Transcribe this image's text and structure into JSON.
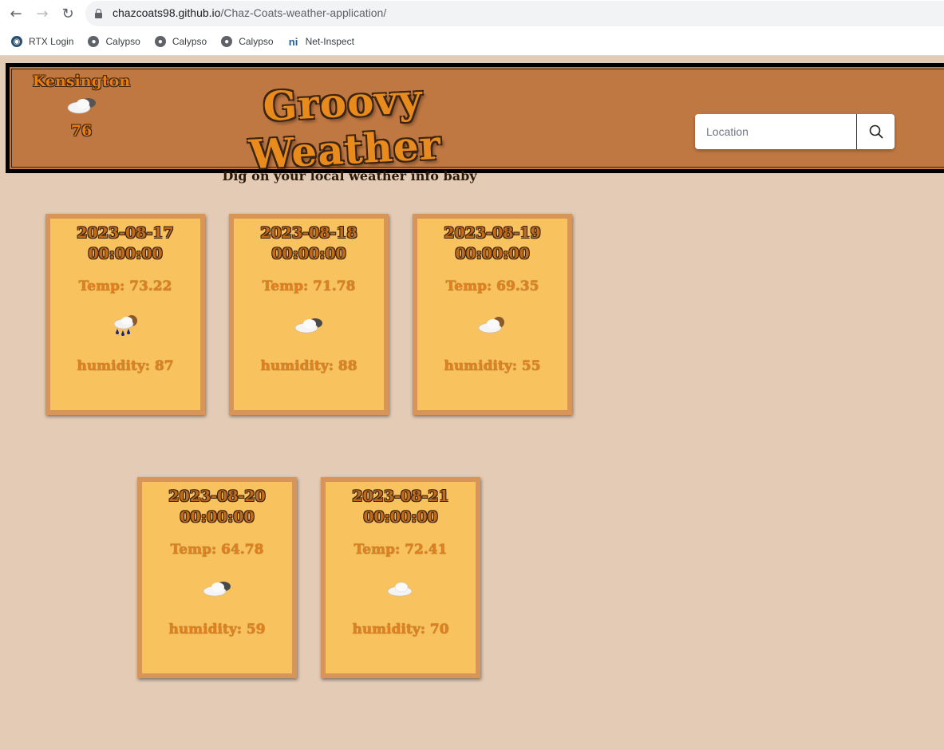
{
  "browser": {
    "url_host": "chazcoats98.github.io",
    "url_path": "/Chaz-Coats-weather-application/",
    "bookmarks": [
      {
        "label": "RTX Login",
        "icon": "rtx-icon"
      },
      {
        "label": "Calypso",
        "icon": "globe-icon"
      },
      {
        "label": "Calypso",
        "icon": "globe-icon"
      },
      {
        "label": "Calypso",
        "icon": "globe-icon"
      },
      {
        "label": "Net-Inspect",
        "icon": "net-inspect-icon"
      }
    ]
  },
  "header": {
    "city": "Kensington",
    "current_icon": "partly-cloudy-icon",
    "current_temp": "76",
    "title": "Groovy Weather",
    "tagline": "Dig on your local weather info baby",
    "search_placeholder": "Location",
    "search_icon": "search-icon"
  },
  "colors": {
    "page_bg": "#e3cbb5",
    "banner_bg": "#c07843",
    "card_bg": "#f8c35f",
    "card_border": "#d8955a",
    "accent_text": "#e0801e"
  },
  "forecast": [
    {
      "date": "2023-08-17",
      "time": "00:00:00",
      "temp": "Temp: 73.22",
      "humidity": "humidity: 87",
      "icon": "rain-night-icon"
    },
    {
      "date": "2023-08-18",
      "time": "00:00:00",
      "temp": "Temp: 71.78",
      "humidity": "humidity: 88",
      "icon": "cloud-night-icon"
    },
    {
      "date": "2023-08-19",
      "time": "00:00:00",
      "temp": "Temp: 69.35",
      "humidity": "humidity: 55",
      "icon": "cloud-night-icon"
    },
    {
      "date": "2023-08-20",
      "time": "00:00:00",
      "temp": "Temp: 64.78",
      "humidity": "humidity: 59",
      "icon": "cloud-night-icon"
    },
    {
      "date": "2023-08-21",
      "time": "00:00:00",
      "temp": "Temp: 72.41",
      "humidity": "humidity: 70",
      "icon": "cloud-icon"
    }
  ]
}
